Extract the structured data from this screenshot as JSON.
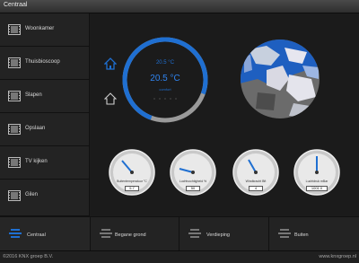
{
  "window": {
    "title": "Centraal"
  },
  "sidebar": {
    "items": [
      {
        "label": "Woonkamer",
        "icon": "film-icon"
      },
      {
        "label": "Thuisbioscoop",
        "icon": "film-icon"
      },
      {
        "label": "Slapen",
        "icon": "film-icon"
      },
      {
        "label": "Opslaan",
        "icon": "film-icon"
      },
      {
        "label": "TV kijken",
        "icon": "film-icon"
      },
      {
        "label": "Gilen",
        "icon": "film-icon"
      }
    ]
  },
  "climate": {
    "setpoint": "20.5 °C",
    "actual": "20.5 °C",
    "mode": "comfort",
    "accent": "#1f6fd1",
    "arc_level": 0.75
  },
  "gauges": [
    {
      "label": "Buitentemperatuur °C",
      "value": "5.7"
    },
    {
      "label": "Luchtvochtigheid %",
      "value": "50"
    },
    {
      "label": "Windkracht Bft",
      "value": "4"
    },
    {
      "label": "Luchtdruk mBar",
      "value": "1001.0"
    }
  ],
  "bottom_bar": [
    {
      "label": "Centraal",
      "active": true
    },
    {
      "label": "Begane grond"
    },
    {
      "label": "Verdieping"
    },
    {
      "label": "Buiten"
    }
  ],
  "footer": {
    "left": "©2016 KNX groep B.V.",
    "right": "www.knxgroep.nl"
  }
}
